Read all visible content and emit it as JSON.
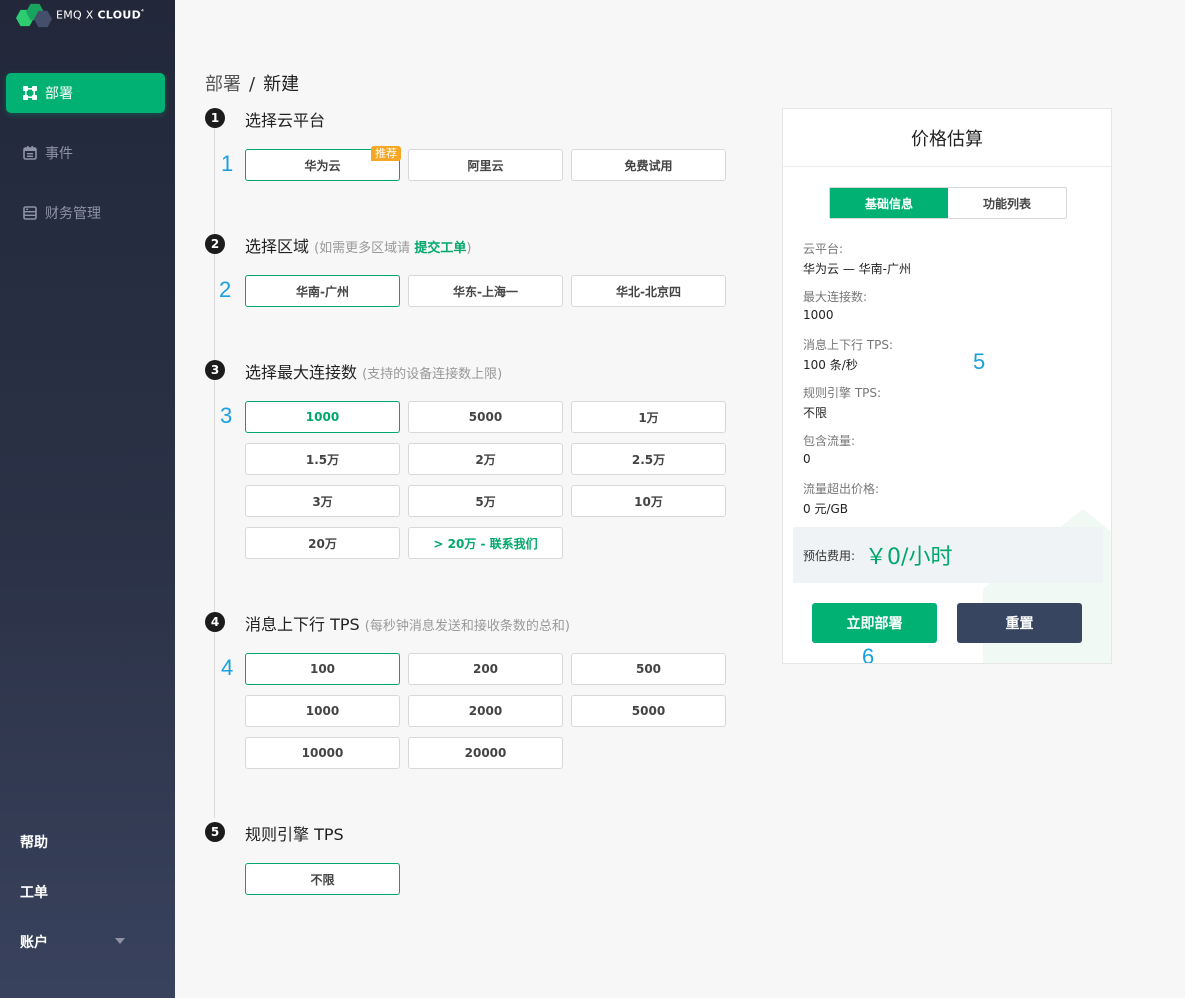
{
  "brand": {
    "name_prefix": "EMQ X ",
    "name_bold": "CLOUD",
    "name_sup": "⁴"
  },
  "sidebar": {
    "items": [
      {
        "label": "部署",
        "icon": "deploy-icon",
        "active": true
      },
      {
        "label": "事件",
        "icon": "calendar-icon",
        "active": false
      },
      {
        "label": "财务管理",
        "icon": "finance-icon",
        "active": false
      }
    ],
    "bottom": {
      "help": "帮助",
      "ticket": "工单",
      "account": "账户"
    }
  },
  "breadcrumb": {
    "parent": "部署",
    "sep": "/",
    "current": "新建"
  },
  "steps": {
    "cloud": {
      "num": "1",
      "title": "选择云平台",
      "marker": "1",
      "options": [
        "华为云",
        "阿里云",
        "免费试用"
      ],
      "badge": "推荐"
    },
    "region": {
      "num": "2",
      "title": "选择区域",
      "hint_prefix": "(如需更多区域请 ",
      "hint_link": "提交工单",
      "hint_suffix": ")",
      "marker": "2",
      "options": [
        "华南-广州",
        "华东-上海一",
        "华北-北京四"
      ]
    },
    "connections": {
      "num": "3",
      "title": "选择最大连接数",
      "hint": "(支持的设备连接数上限)",
      "marker": "3",
      "options": [
        "1000",
        "5000",
        "1万",
        "1.5万",
        "2万",
        "2.5万",
        "3万",
        "5万",
        "10万",
        "20万",
        "> 20万 - 联系我们"
      ]
    },
    "tps": {
      "num": "4",
      "title": "消息上下行 TPS",
      "hint": "(每秒钟消息发送和接收条数的总和)",
      "marker": "4",
      "options": [
        "100",
        "200",
        "500",
        "1000",
        "2000",
        "5000",
        "10000",
        "20000"
      ]
    },
    "rule": {
      "num": "5",
      "title": "规则引擎 TPS",
      "options": [
        "不限"
      ]
    }
  },
  "price": {
    "title": "价格估算",
    "tabs": [
      "基础信息",
      "功能列表"
    ],
    "marker": "5",
    "fields": [
      {
        "label": "云平台:",
        "value": "华为云 — 华南-广州"
      },
      {
        "label": "最大连接数:",
        "value": "1000"
      },
      {
        "label": "消息上下行 TPS:",
        "value": "100 条/秒"
      },
      {
        "label": "规则引擎 TPS:",
        "value": "不限"
      },
      {
        "label": "包含流量:",
        "value": "0"
      },
      {
        "label": "流量超出价格:",
        "value": "0 元/GB"
      }
    ],
    "estimate_label": "预估费用:",
    "estimate_value": "￥0/小时",
    "deploy_button": "立即部署",
    "reset_button": "重置",
    "button_marker": "6"
  },
  "colors": {
    "accent": "#00b173",
    "link": "#00a86b",
    "badge": "#f5a623",
    "reset": "#374561",
    "marker": "#1a9fe0"
  }
}
